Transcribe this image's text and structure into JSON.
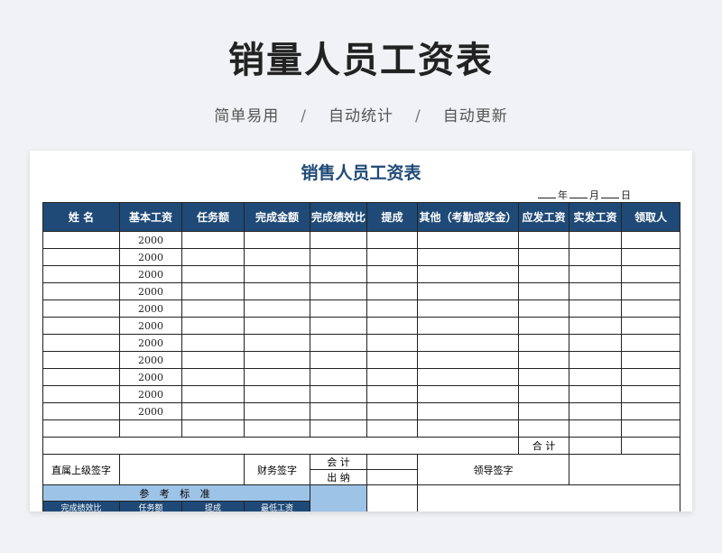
{
  "banner": {
    "title": "销量人员工资表",
    "features": [
      "简单易用",
      "自动统计",
      "自动更新"
    ],
    "separator": "/"
  },
  "sheet": {
    "title": "销售人员工资表",
    "date": {
      "year": "年",
      "month": "月",
      "day": "日"
    },
    "columns": [
      "姓 名",
      "基本工资",
      "任务额",
      "完成金额",
      "完成绩效比",
      "提成",
      "其他（考勤或奖金）",
      "应发工资",
      "实发工资",
      "领取人"
    ],
    "rows": [
      {
        "base_salary": "2000"
      },
      {
        "base_salary": "2000"
      },
      {
        "base_salary": "2000"
      },
      {
        "base_salary": "2000"
      },
      {
        "base_salary": "2000"
      },
      {
        "base_salary": "2000"
      },
      {
        "base_salary": "2000"
      },
      {
        "base_salary": "2000"
      },
      {
        "base_salary": "2000"
      },
      {
        "base_salary": "2000"
      },
      {
        "base_salary": "2000"
      }
    ],
    "total_label": "合 计",
    "signatures": {
      "supervisor": "直属上级签字",
      "finance": "财务签字",
      "accountant": "会 计",
      "cashier": "出 纳",
      "leader": "领导签字"
    },
    "reference": {
      "title": "参 考 标 准",
      "columns": [
        "完成绩效比",
        "任务额",
        "提成",
        "最低工资"
      ]
    }
  },
  "colors": {
    "header_bg": "#1f4a77",
    "reference_bg": "#9dc3e6",
    "title": "#1f4a77"
  }
}
